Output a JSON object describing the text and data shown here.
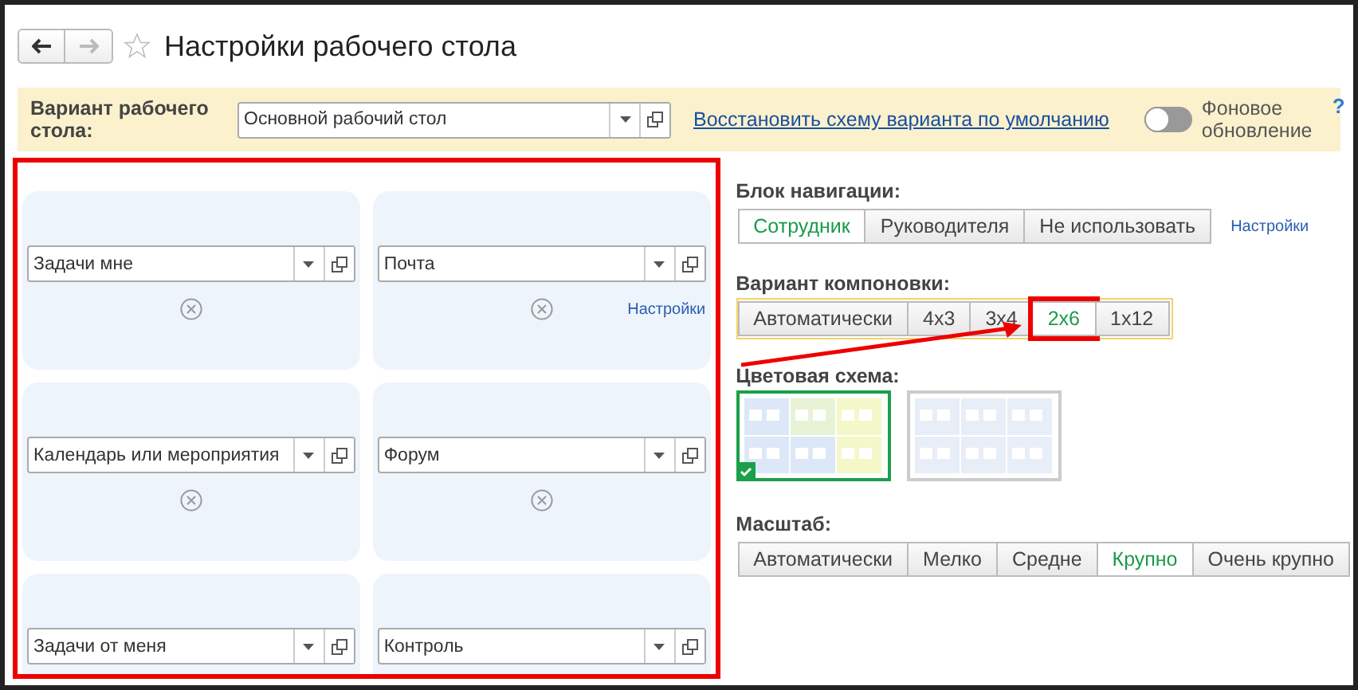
{
  "window": {
    "title": "Настройки рабочего стола",
    "favorite": false
  },
  "variant": {
    "label": "Вариант рабочего стола:",
    "value": "Основной рабочий стол",
    "restore_link": "Восстановить схему варианта по умолчанию",
    "background_update": {
      "label": "Фоновое обновление",
      "on": false
    },
    "help": "?"
  },
  "widgets": {
    "highlighted": true,
    "cells": [
      {
        "value": "Задачи мне",
        "removable": true
      },
      {
        "value": "Почта",
        "removable": true,
        "settings": "Настройки"
      },
      {
        "value": "Календарь или мероприятия",
        "removable": true
      },
      {
        "value": "Форум",
        "removable": true
      },
      {
        "value": "Задачи от меня"
      },
      {
        "value": "Контроль"
      }
    ]
  },
  "navigation": {
    "label": "Блок навигации:",
    "settings": "Настройки",
    "options": [
      {
        "label": "Сотрудник",
        "selected": true
      },
      {
        "label": "Руководителя",
        "selected": false
      },
      {
        "label": "Не использовать",
        "selected": false
      }
    ]
  },
  "layout": {
    "label": "Вариант компоновки:",
    "options": [
      {
        "label": "Автоматически",
        "selected": false,
        "highlighted": false
      },
      {
        "label": "4x3",
        "selected": false,
        "highlighted": false
      },
      {
        "label": "3x4",
        "selected": false,
        "highlighted": false
      },
      {
        "label": "2x6",
        "selected": true,
        "highlighted": true
      },
      {
        "label": "1x12",
        "selected": false,
        "highlighted": false
      }
    ]
  },
  "color_scheme": {
    "label": "Цветовая схема:",
    "options": [
      {
        "kind": "colored",
        "selected": true
      },
      {
        "kind": "plain",
        "selected": false
      }
    ]
  },
  "scale": {
    "label": "Масштаб:",
    "options": [
      {
        "label": "Автоматически",
        "selected": false
      },
      {
        "label": "Мелко",
        "selected": false
      },
      {
        "label": "Средне",
        "selected": false
      },
      {
        "label": "Крупно",
        "selected": true
      },
      {
        "label": "Очень крупно",
        "selected": false
      }
    ]
  }
}
